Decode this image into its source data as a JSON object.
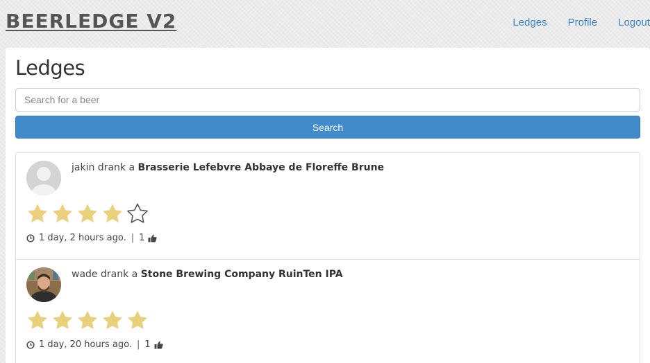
{
  "header": {
    "brand": "BEERLEDGE V2",
    "nav": [
      "Ledges",
      "Profile",
      "Logout"
    ]
  },
  "main": {
    "title": "Ledges",
    "search": {
      "placeholder": "Search for a beer",
      "value": "",
      "button_label": "Search"
    },
    "feed": [
      {
        "user": "jakin",
        "verb": "drank a",
        "beer": "Brasserie Lefebvre Abbaye de Floreffe Brune",
        "rating": 4,
        "max_rating": 5,
        "time": "1 day, 2 hours ago.",
        "separator": "|",
        "likes": "1",
        "avatar_icon": "default-user-icon"
      },
      {
        "user": "wade",
        "verb": "drank a",
        "beer": "Stone Brewing Company RuinTen IPA",
        "rating": 5,
        "max_rating": 5,
        "time": "1 day, 20 hours ago.",
        "separator": "|",
        "likes": "1",
        "avatar_icon": "user-photo"
      }
    ]
  },
  "colors": {
    "accent": "#428bca",
    "link": "#3d85c6",
    "star_filled": "#e8d07d",
    "star_empty_stroke": "#555555",
    "brand": "#555555"
  }
}
